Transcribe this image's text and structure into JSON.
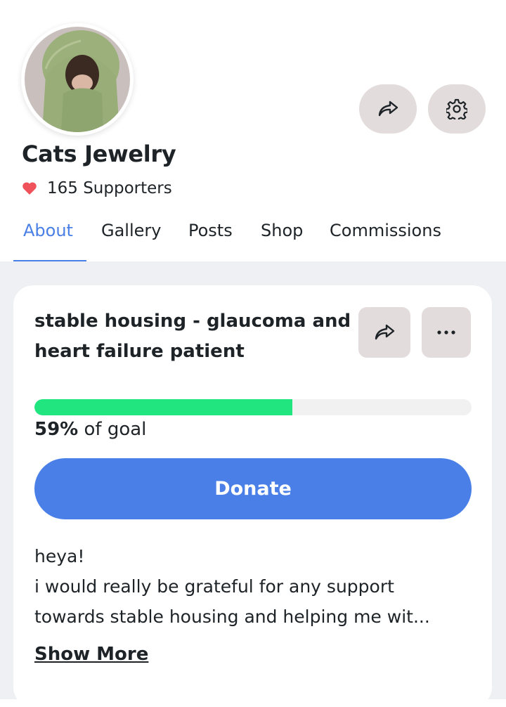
{
  "profile": {
    "name": "Cats Jewelry",
    "supporters": "165 Supporters"
  },
  "tabs": [
    {
      "label": "About",
      "active": true
    },
    {
      "label": "Gallery"
    },
    {
      "label": "Posts"
    },
    {
      "label": "Shop"
    },
    {
      "label": "Commissions"
    }
  ],
  "goal": {
    "title_line1": "stable housing - glaucoma and",
    "title_line2": "heart failure patient",
    "percent": 59,
    "percent_label": "59%",
    "suffix": " of goal",
    "donate_label": "Donate"
  },
  "description": {
    "lines": [
      "heya!",
      "i would really be grateful for any support",
      "towards stable housing and helping me wit..."
    ],
    "show_more_label": "Show More"
  },
  "icons": {
    "share": "share-icon",
    "settings": "gear-icon",
    "more": "more-dots-icon",
    "heart": "heart-icon"
  },
  "colors": {
    "accent": "#4a7fe6",
    "progress": "#21e57f",
    "heart": "#f0525b",
    "button_bg": "#e3dcdc",
    "page_bg": "#eef0f4"
  }
}
